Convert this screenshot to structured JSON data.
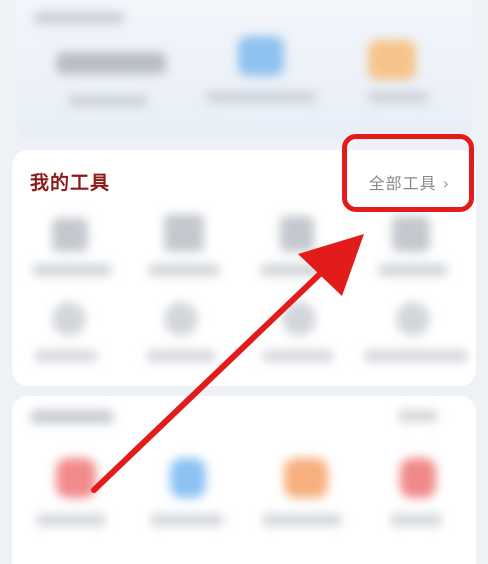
{
  "tools_section": {
    "title": "我的工具",
    "all_tools_label": "全部工具",
    "chevron": "chevron-right-icon"
  },
  "annotation": {
    "highlight_color": "#e21b1b",
    "arrow_color": "#e21b1b"
  }
}
